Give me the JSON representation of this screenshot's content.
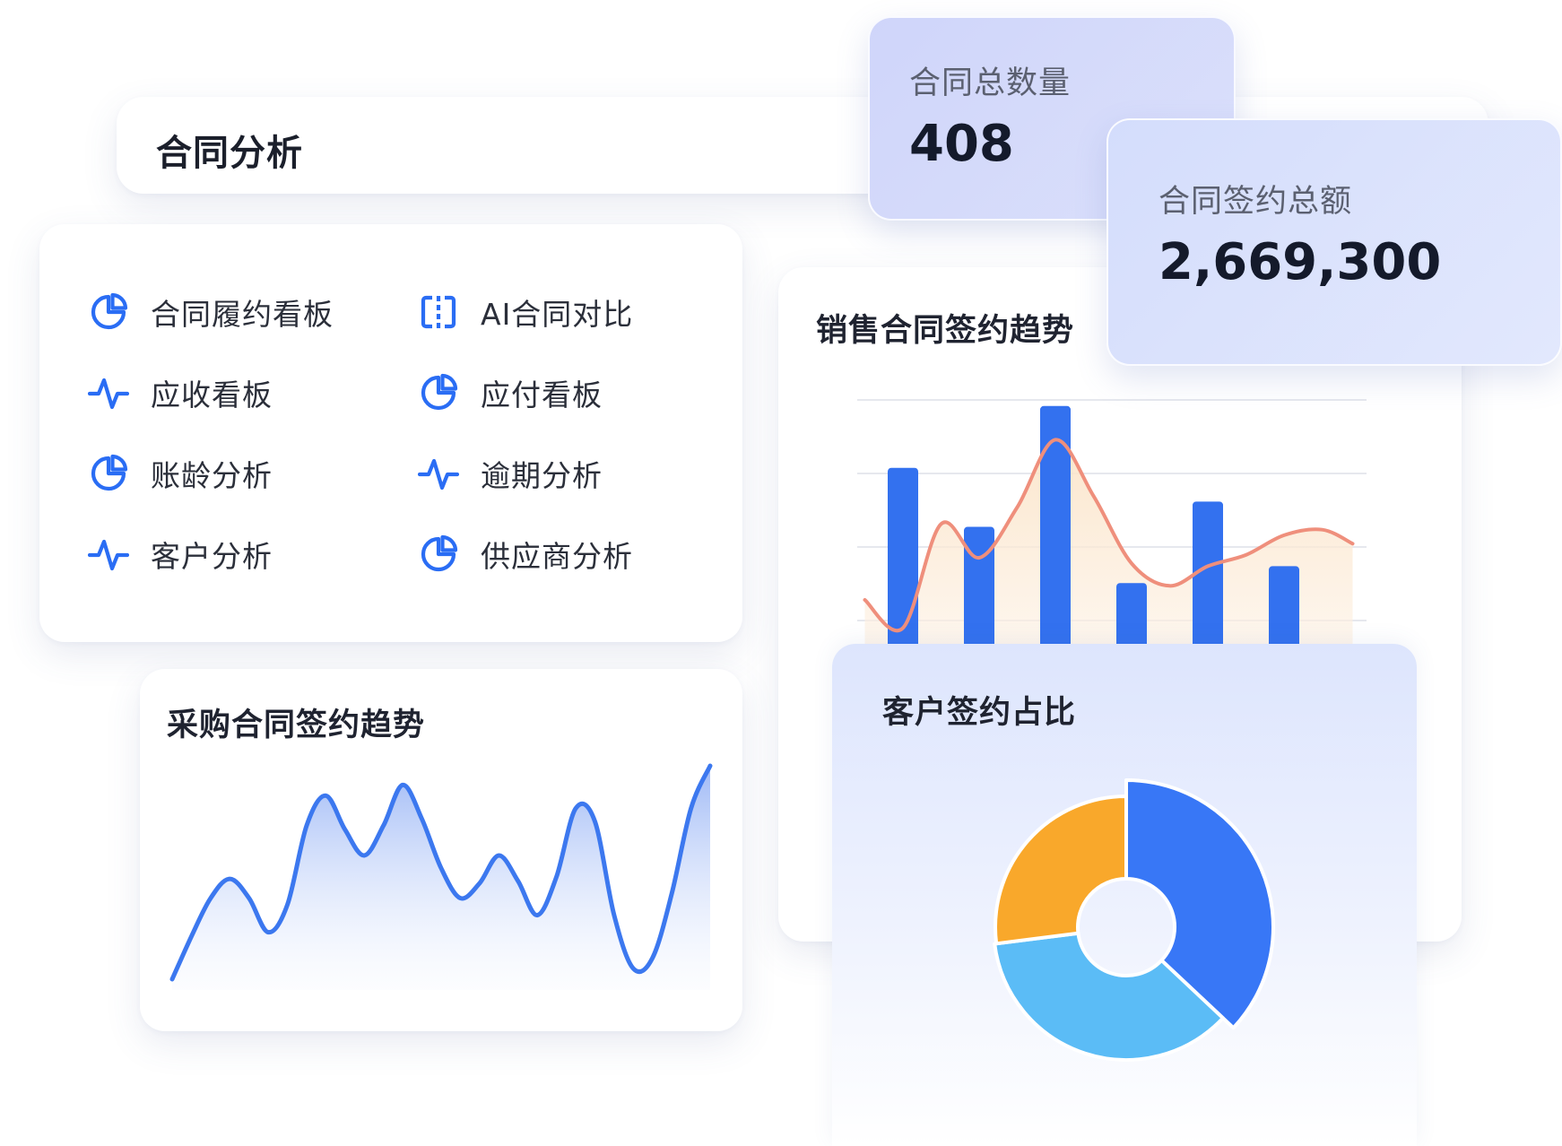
{
  "header": {
    "title": "合同分析"
  },
  "menu": {
    "items": [
      {
        "label": "合同履约看板",
        "icon": "pie-chart-icon"
      },
      {
        "label": "AI合同对比",
        "icon": "compare-icon"
      },
      {
        "label": "应收看板",
        "icon": "pulse-icon"
      },
      {
        "label": "应付看板",
        "icon": "pie-chart-icon"
      },
      {
        "label": "账龄分析",
        "icon": "pie-chart-icon"
      },
      {
        "label": "逾期分析",
        "icon": "pulse-icon"
      },
      {
        "label": "客户分析",
        "icon": "pulse-icon"
      },
      {
        "label": "供应商分析",
        "icon": "pie-chart-icon"
      }
    ]
  },
  "stats": {
    "count": {
      "label": "合同总数量",
      "value": "408"
    },
    "amount": {
      "label": "合同签约总额",
      "value": "2,669,300"
    }
  },
  "purchase_chart": {
    "title": "采购合同签约趋势"
  },
  "sales_chart": {
    "title": "销售合同签约趋势"
  },
  "customer_chart": {
    "title": "客户签约占比"
  },
  "colors": {
    "accent": "#2a6df4",
    "bar": "#3371ef",
    "trend_line": "#ef8f7c",
    "trend_fill": "#fdeedc",
    "line_blue": "#3c78ef",
    "pie_blue": "#3877f6",
    "pie_sky": "#5bbcf6",
    "pie_orange": "#f9a82b"
  },
  "chart_data": [
    {
      "type": "area",
      "title": "采购合同签约趋势",
      "x": [
        0,
        1,
        2,
        3,
        4,
        5,
        6,
        7,
        8,
        9,
        10,
        11,
        12,
        13,
        14,
        15,
        16,
        17,
        18,
        19,
        20,
        21,
        22,
        23,
        24,
        25,
        26,
        27,
        28
      ],
      "values": [
        0,
        20,
        38,
        47,
        38,
        22,
        35,
        72,
        86,
        70,
        58,
        72,
        91,
        75,
        52,
        38,
        45,
        58,
        46,
        30,
        48,
        80,
        74,
        30,
        5,
        10,
        40,
        80,
        100
      ],
      "ylim": [
        0,
        100
      ],
      "grid": false
    },
    {
      "type": "bar",
      "title": "销售合同签约趋势",
      "categories": [
        "1",
        "2",
        "3",
        "4",
        "5",
        "6"
      ],
      "values": [
        62,
        41,
        84,
        21,
        50,
        27
      ],
      "line": {
        "x": [
          -0.5,
          0,
          0.5,
          1,
          1.5,
          2,
          2.5,
          3,
          3.5,
          4,
          4.5,
          5,
          5.5,
          5.9
        ],
        "values": [
          15,
          5,
          42,
          30,
          48,
          72,
          52,
          28,
          20,
          27,
          31,
          38,
          40,
          35
        ]
      },
      "ylim": [
        0,
        90
      ],
      "grid": true
    },
    {
      "type": "pie",
      "title": "客户签约占比",
      "donut": true,
      "slices": [
        {
          "value": 37,
          "color": "#3877f6"
        },
        {
          "value": 36,
          "color": "#5bbcf6"
        },
        {
          "value": 27,
          "color": "#f9a82b"
        }
      ]
    }
  ]
}
